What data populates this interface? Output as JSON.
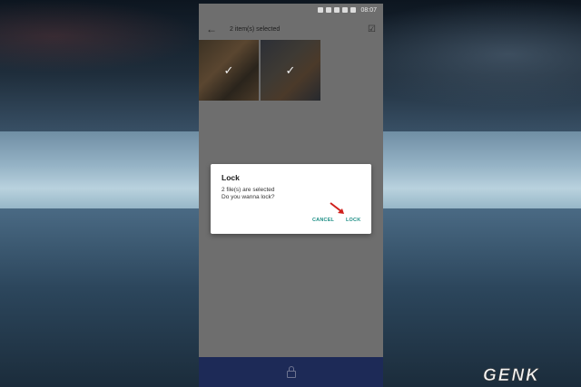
{
  "status_bar": {
    "time": "08:07",
    "icons": [
      "alarm-icon",
      "wifi-icon",
      "sim-icon",
      "signal-icon",
      "battery-icon"
    ]
  },
  "app_bar": {
    "title": "2 item(s) selected",
    "back_icon": "arrow-left-icon",
    "select_all_icon": "checkbox-checked-icon"
  },
  "thumbnails": [
    {
      "selected": true,
      "icon": "check-icon",
      "tick": "✓"
    },
    {
      "selected": true,
      "icon": "check-icon",
      "tick": "✓"
    }
  ],
  "dialog": {
    "title": "Lock",
    "line1": "2 file(s) are selected",
    "line2": "Do you wanna lock?",
    "cancel_label": "CANCEL",
    "lock_label": "LOCK"
  },
  "bottom_bar": {
    "icon": "lock-icon"
  },
  "annotation": {
    "icon": "red-arrow-icon",
    "color": "#d0201c"
  },
  "watermark": {
    "text": "GENK"
  },
  "colors": {
    "dialog_button": "#1e8f86",
    "bottom_bar": "#1d2a57",
    "overlay": "#6e6e6e"
  }
}
